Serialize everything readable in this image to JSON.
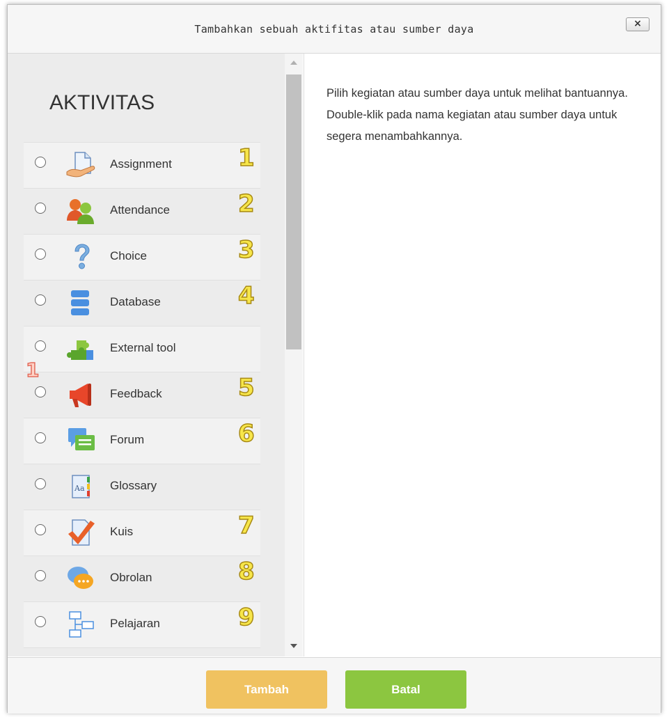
{
  "dialog": {
    "title": "Tambahkan sebuah aktifitas atau sumber daya",
    "close_label": "×",
    "section_heading": "AKTIVITAS",
    "help_text": "Pilih kegiatan atau sumber daya untuk melihat bantuannya. Double-klik pada nama kegiatan atau sumber daya untuk segera menambahkannya.",
    "side_marker": "1",
    "activities": [
      {
        "label": "Assignment",
        "number": "1",
        "icon": "assignment-icon"
      },
      {
        "label": "Attendance",
        "number": "2",
        "icon": "attendance-icon"
      },
      {
        "label": "Choice",
        "number": "3",
        "icon": "choice-icon"
      },
      {
        "label": "Database",
        "number": "4",
        "icon": "database-icon"
      },
      {
        "label": "External tool",
        "number": "",
        "icon": "external-tool-icon"
      },
      {
        "label": "Feedback",
        "number": "5",
        "icon": "feedback-icon"
      },
      {
        "label": "Forum",
        "number": "6",
        "icon": "forum-icon"
      },
      {
        "label": "Glossary",
        "number": "",
        "icon": "glossary-icon"
      },
      {
        "label": "Kuis",
        "number": "7",
        "icon": "quiz-icon"
      },
      {
        "label": "Obrolan",
        "number": "8",
        "icon": "chat-icon"
      },
      {
        "label": "Pelajaran",
        "number": "9",
        "icon": "lesson-icon"
      },
      {
        "label": "",
        "number": "",
        "icon": "package-icon"
      }
    ],
    "buttons": {
      "add": "Tambah",
      "cancel": "Batal"
    }
  }
}
